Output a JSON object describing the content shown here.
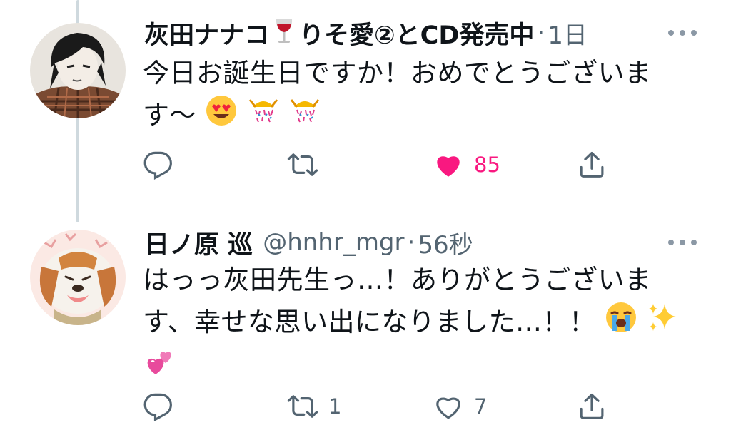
{
  "tweets": [
    {
      "display_name": "灰田ナナコ",
      "name_emoji": "wine-glass",
      "name_suffix": "りそ愛②とCD発売中",
      "handle": "",
      "separator": "·",
      "time": "1日",
      "text_lines": [
        "今日お誕生日ですか！おめでとうございま",
        "す〜"
      ],
      "text_emojis": [
        "smiling-face-with-heart-eyes",
        "confetti-ball",
        "confetti-ball"
      ],
      "actions": {
        "reply": "",
        "retweet": "",
        "like": "85",
        "like_state": "liked",
        "share": ""
      }
    },
    {
      "display_name": "日ノ原 巡",
      "handle": "@hnhr_mgr",
      "separator": "·",
      "time": "56秒",
      "text_lines": [
        "はっっ灰田先生っ…！ありがとうございま",
        "す、幸せな思い出になりました…！！"
      ],
      "text_emojis": [
        "loudly-crying-face",
        "sparkles",
        "two-hearts"
      ],
      "actions": {
        "reply": "",
        "retweet": "1",
        "like": "7",
        "like_state": "unliked",
        "share": ""
      }
    }
  ],
  "colors": {
    "like_pink": "#f91880",
    "icon_gray": "#536471",
    "thread_line": "#cfd9de"
  }
}
